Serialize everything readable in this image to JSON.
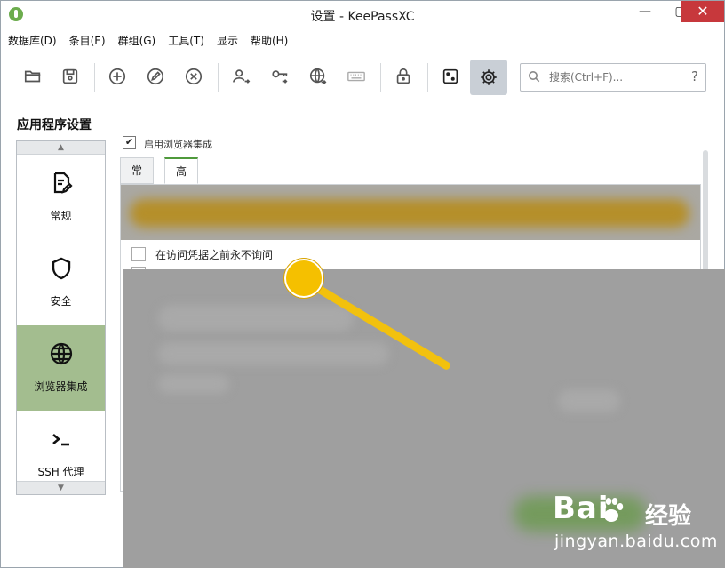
{
  "window": {
    "title": "设置 - KeePassXC",
    "minimize": "—",
    "maximize": "▢",
    "close": "✕"
  },
  "menu": [
    "数据库(D)",
    "条目(E)",
    "群组(G)",
    "工具(T)",
    "显示",
    "帮助(H)"
  ],
  "toolbar": {
    "buttons": [
      {
        "name": "open-database",
        "icon": "folder-icon"
      },
      {
        "name": "save-database",
        "icon": "save-icon"
      },
      {
        "name": "add-entry",
        "icon": "plus-circle-icon"
      },
      {
        "name": "edit-entry",
        "icon": "pencil-circle-icon"
      },
      {
        "name": "delete-entry",
        "icon": "x-circle-icon"
      },
      {
        "name": "copy-username",
        "icon": "user-arrow-icon"
      },
      {
        "name": "copy-password",
        "icon": "key-arrow-icon"
      },
      {
        "name": "copy-url",
        "icon": "globe-arrow-icon"
      },
      {
        "name": "auto-type",
        "icon": "keyboard-icon"
      },
      {
        "name": "lock-database",
        "icon": "lock-icon"
      },
      {
        "name": "password-generator",
        "icon": "dice-icon"
      },
      {
        "name": "settings",
        "icon": "gear-icon",
        "active": true
      }
    ]
  },
  "search": {
    "placeholder": "搜索(Ctrl+F)...",
    "help": "?"
  },
  "settings": {
    "section_title": "应用程序设置",
    "categories": [
      {
        "label": "常规",
        "icon": "document-edit-icon"
      },
      {
        "label": "安全",
        "icon": "shield-icon"
      },
      {
        "label": "浏览器集成",
        "icon": "globe-icon",
        "selected": true
      },
      {
        "label": "SSH 代理",
        "icon": "terminal-icon"
      }
    ],
    "enable_browser_label": "启用浏览器集成",
    "enable_browser_checked": true,
    "tabs": [
      {
        "label": "常规"
      },
      {
        "label": "高级",
        "active": true
      }
    ],
    "options": [
      {
        "label": "在访问凭据之前永不询问",
        "checked": false
      }
    ]
  },
  "watermark": {
    "logo": "Bai",
    "brand": "经验",
    "url": "jingyan.baidu.com"
  },
  "colors": {
    "selected_category": "#a3bd8f",
    "accent_green": "#4f9a3b",
    "pointer": "#f5c000",
    "close_button": "#c7383c"
  }
}
